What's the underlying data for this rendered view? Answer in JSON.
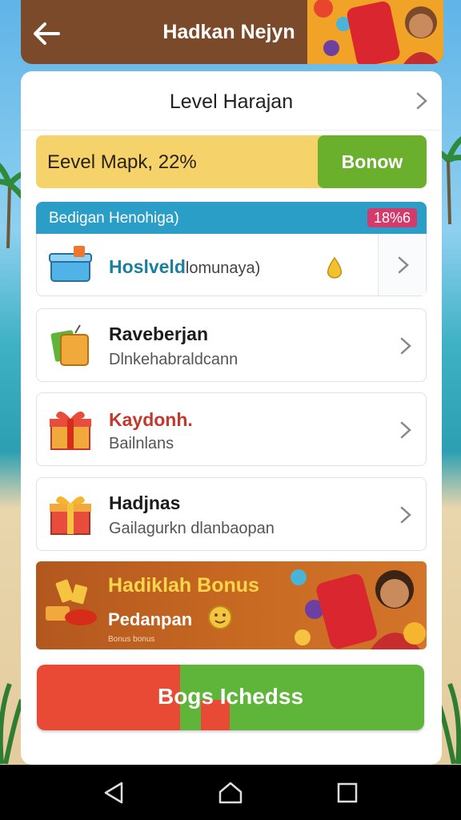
{
  "header": {
    "title": "Hadkan Nejyn"
  },
  "level": {
    "label": "Level Harajan"
  },
  "progress": {
    "text": "Eevel Mapk, 22%",
    "button": "Bonow"
  },
  "section": {
    "title": "Bedigan Henohiga)",
    "badge": "18%6"
  },
  "items": [
    {
      "title": "Hoslveld",
      "title_rest": "lomunaya)",
      "icon": "box-icon"
    },
    {
      "title": "Raveberjan",
      "subtitle": "Dlnkehabraldcann",
      "icon": "bag-icon"
    },
    {
      "title": "Kaydonh.",
      "subtitle": "Bailnlans",
      "icon": "gift-icon"
    },
    {
      "title": "Hadjnas",
      "subtitle": "Gailagurkn dlanbaopan",
      "icon": "gift-icon"
    }
  ],
  "bonus": {
    "title": "Hadiklah Bonus",
    "subtitle": "Pedanpan",
    "small": "Bonus bonus"
  },
  "cta": {
    "label": "Bogs Ichedss"
  },
  "colors": {
    "header": "#7a4a2a",
    "accent_green": "#6ab02c",
    "accent_yellow": "#f6d36a",
    "section_blue": "#2a9ec7",
    "cta_red": "#e94a35",
    "cta_green": "#5fb43a"
  }
}
